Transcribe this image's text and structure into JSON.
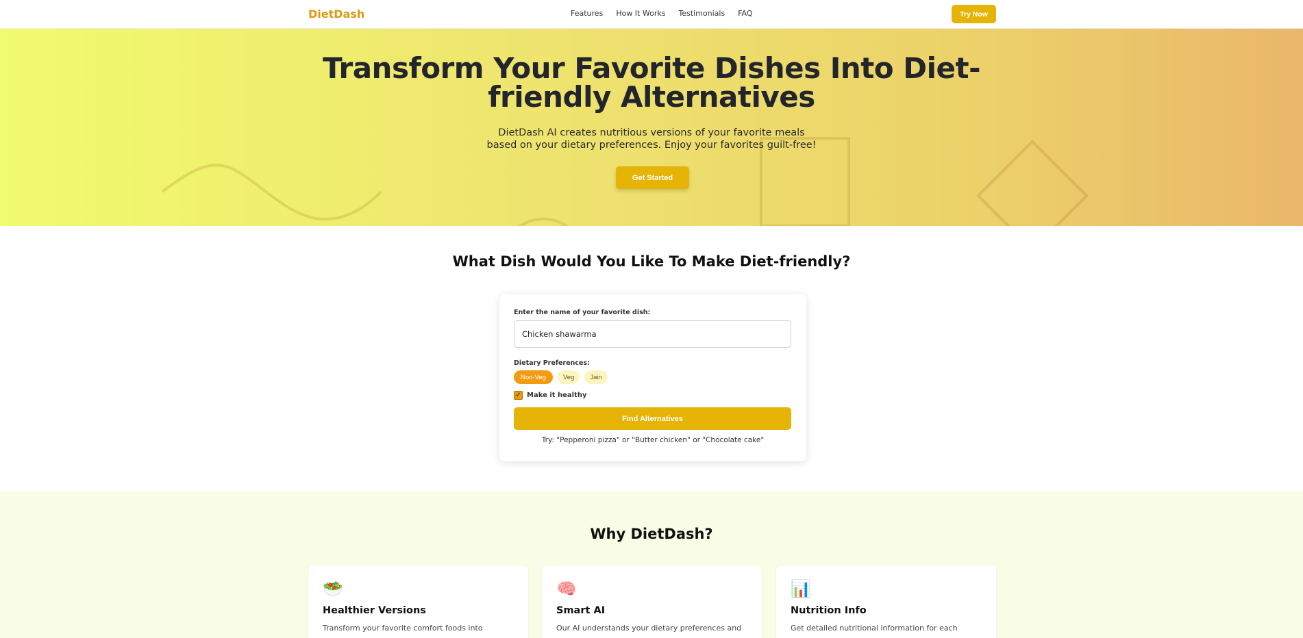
{
  "nav": {
    "logo": "DietDash",
    "links": [
      "Features",
      "How It Works",
      "Testimonials",
      "FAQ"
    ],
    "cta": "Try Now"
  },
  "hero": {
    "title_line1": "Transform Your Favorite Dishes Into Diet-",
    "title_line2": "friendly Alternatives",
    "subtitle_line1": "DietDash AI creates nutritious versions of your favorite meals",
    "subtitle_line2": "based on your dietary preferences. Enjoy your favorites guilt-free!",
    "cta": "Get Started"
  },
  "form": {
    "heading": "What Dish Would You Like To Make Diet-friendly?",
    "dish_label": "Enter the name of your favorite dish:",
    "dish_value": "Chicken shawarma",
    "prefs_label": "Dietary Preferences:",
    "prefs": [
      "Non-Veg",
      "Veg",
      "Jain"
    ],
    "selected_pref": "Non-Veg",
    "healthy_label": "Make it healthy",
    "healthy_checked": true,
    "submit": "Find Alternatives",
    "hint": "Try: \"Pepperoni pizza\" or \"Butter chicken\" or \"Chocolate cake\""
  },
  "why": {
    "heading": "Why DietDash?",
    "cards": [
      {
        "icon": "salad-icon",
        "glyph": "🥗",
        "title": "Healthier Versions",
        "desc": "Transform your favorite comfort foods into"
      },
      {
        "icon": "brain-icon",
        "glyph": "🧠",
        "title": "Smart AI",
        "desc": "Our AI understands your dietary preferences and"
      },
      {
        "icon": "bar-chart-icon",
        "glyph": "📊",
        "title": "Nutrition Info",
        "desc": "Get detailed nutritional information for each"
      }
    ]
  },
  "colors": {
    "accent": "#e6b407",
    "logo": "#dc9a10",
    "chip_active": "#f39c12",
    "chip_idle": "#fbf6c0",
    "why_bg": "#f9fde6"
  }
}
